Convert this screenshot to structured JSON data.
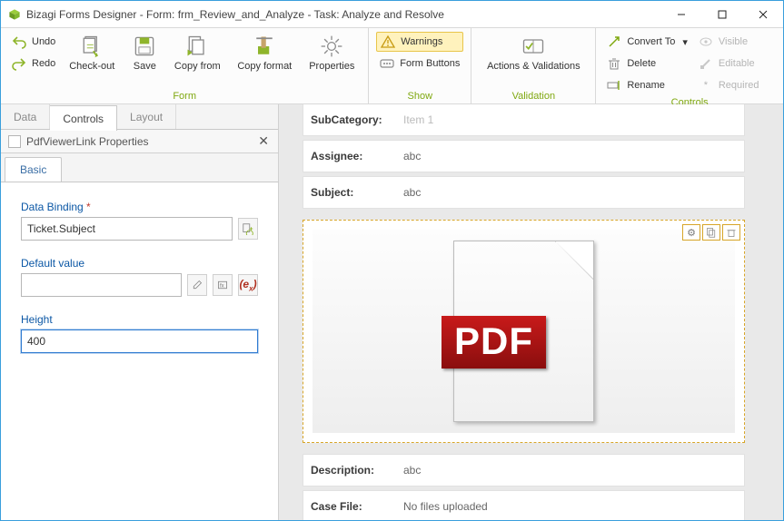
{
  "titlebar": {
    "title": "Bizagi Forms Designer  - Form: frm_Review_and_Analyze - Task:  Analyze and Resolve"
  },
  "ribbon": {
    "undo": "Undo",
    "redo": "Redo",
    "checkout": "Check-out",
    "save": "Save",
    "copyfrom": "Copy from",
    "copyformat": "Copy format",
    "properties": "Properties",
    "group_form": "Form",
    "warnings": "Warnings",
    "formbuttons": "Form Buttons",
    "group_show": "Show",
    "actions": "Actions & Validations",
    "group_validation": "Validation",
    "convertto": "Convert To",
    "delete": "Delete",
    "rename": "Rename",
    "visible": "Visible",
    "editable": "Editable",
    "required": "Required",
    "group_controls": "Controls"
  },
  "left": {
    "tabs": {
      "data": "Data",
      "controls": "Controls",
      "layout": "Layout"
    },
    "panel_title": "PdfViewerLink Properties",
    "basic_tab": "Basic",
    "databinding_label": "Data Binding",
    "databinding_value": "Ticket.Subject",
    "default_label": "Default value",
    "default_value": "",
    "height_label": "Height",
    "height_value": "400"
  },
  "form": {
    "rows": {
      "subcategory": {
        "label": "SubCategory:",
        "value": "Item 1"
      },
      "assignee": {
        "label": "Assignee:",
        "value": "abc"
      },
      "subject": {
        "label": "Subject:",
        "value": "abc"
      },
      "description": {
        "label": "Description:",
        "value": "abc"
      },
      "casefile": {
        "label": "Case File:",
        "value": "No files uploaded"
      }
    },
    "pdf_text": "PDF"
  }
}
